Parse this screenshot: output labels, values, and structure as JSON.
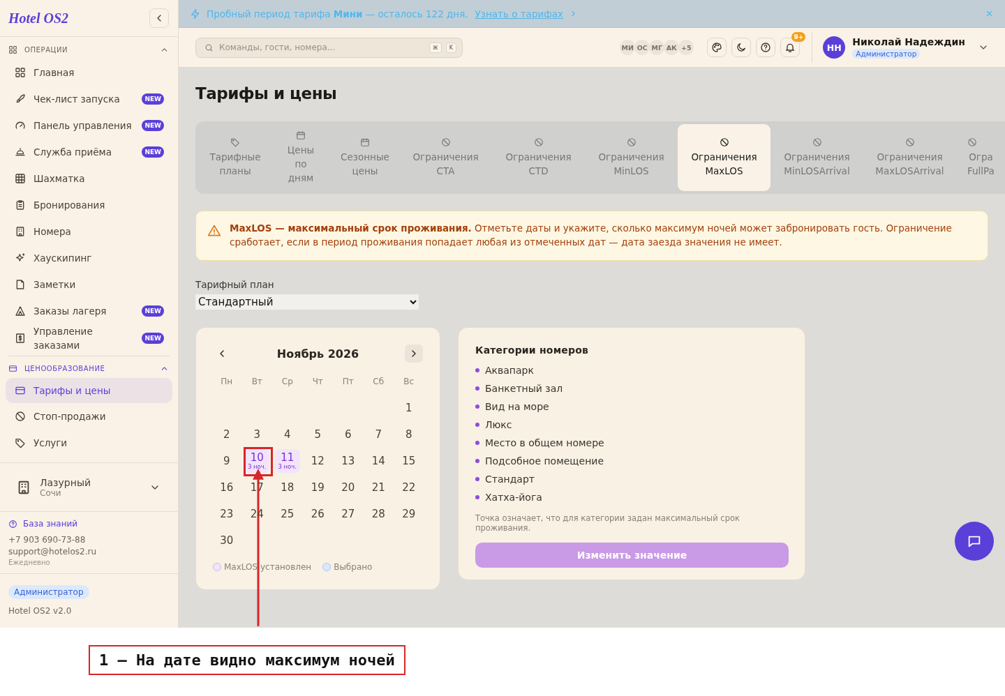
{
  "sidebar": {
    "logo": "Hotel OS2",
    "sections": [
      {
        "title": "ОПЕРАЦИИ",
        "active": false,
        "expanded": true,
        "items": [
          {
            "label": "Главная",
            "selected": false
          },
          {
            "label": "Чек-лист запуска",
            "badge": "NEW",
            "selected": false
          },
          {
            "label": "Панель управления",
            "badge": "NEW",
            "selected": false
          },
          {
            "label": "Служба приёма",
            "badge": "NEW",
            "selected": false
          },
          {
            "label": "Шахматка",
            "selected": false
          },
          {
            "label": "Бронирования",
            "selected": false
          },
          {
            "label": "Номера",
            "selected": false
          },
          {
            "label": "Хаускипинг",
            "selected": false
          },
          {
            "label": "Заметки",
            "selected": false
          },
          {
            "label": "Заказы лагеря",
            "badge": "NEW",
            "selected": false
          },
          {
            "label": "Управление заказами",
            "badge": "NEW",
            "selected": false
          }
        ]
      },
      {
        "title": "ЦЕНООБРАЗОВАНИЕ",
        "active": true,
        "expanded": true,
        "items": [
          {
            "label": "Тарифы и цены",
            "selected": true
          },
          {
            "label": "Стоп-продажи",
            "selected": false
          },
          {
            "label": "Услуги",
            "selected": false
          }
        ]
      }
    ],
    "hotel": {
      "name": "Лазурный",
      "city": "Сочи"
    },
    "support": {
      "link": "База знаний",
      "phone": "+7 903 690-73-88",
      "email": "support@hotelos2.ru",
      "hours": "Ежедневно"
    },
    "footer": {
      "role": "Администратор",
      "version": "Hotel OS2 v2.0"
    }
  },
  "banner": {
    "text": "Пробный период тарифа **Мини** — осталось 122 дня.",
    "link": "Узнать о тарифах"
  },
  "header": {
    "search": {
      "placeholder": "Команды, гости, номера...",
      "keys": [
        "⌘",
        "K"
      ]
    },
    "avatars": [
      "МИ",
      "ОС",
      "МГ",
      "АК",
      "+5"
    ],
    "notifications": "9+",
    "user": {
      "initials": "НН",
      "name": "Николай Надеждин",
      "role": "Администратор"
    }
  },
  "page": {
    "title": "Тарифы и цены",
    "tabs": [
      {
        "lines": [
          "Тарифные",
          "планы"
        ],
        "selected": false
      },
      {
        "lines": [
          "Цены",
          "по",
          "дням"
        ],
        "selected": false
      },
      {
        "lines": [
          "Сезонные",
          "цены"
        ],
        "selected": false
      },
      {
        "lines": [
          "Ограничения",
          "CTA"
        ],
        "selected": false
      },
      {
        "lines": [
          "Ограничения",
          "CTD"
        ],
        "selected": false
      },
      {
        "lines": [
          "Ограничения",
          "MinLOS"
        ],
        "selected": false
      },
      {
        "lines": [
          "Ограничения",
          "MaxLOS"
        ],
        "selected": true
      },
      {
        "lines": [
          "Ограничения",
          "MinLOSArrival"
        ],
        "selected": false
      },
      {
        "lines": [
          "Ограничения",
          "MaxLOSArrival"
        ],
        "selected": false
      },
      {
        "lines": [
          "Огра",
          "FullPa"
        ],
        "selected": false
      }
    ],
    "alert": "**MaxLOS — максимальный срок проживания.** Отметьте даты и укажите, сколько максимум ночей может забронировать гость. Ограничение сработает, если в период проживания попадает любая из отмеченных дат — дата заезда значения не имеет.",
    "rate_plan": {
      "label": "Тарифный план",
      "value": "Стандартный"
    },
    "calendar": {
      "month": "Ноябрь 2026",
      "weekdays": [
        "Пн",
        "Вт",
        "Ср",
        "Чт",
        "Пт",
        "Сб",
        "Вс"
      ],
      "weeks": [
        [
          {
            "day": "1",
            "maxlos": false,
            "selected": false,
            "marked": false
          }
        ],
        [
          {
            "day": "2",
            "maxlos": false,
            "selected": false,
            "marked": false
          },
          {
            "day": "3",
            "maxlos": false,
            "selected": false,
            "marked": false
          },
          {
            "day": "4",
            "maxlos": false,
            "selected": false,
            "marked": false
          },
          {
            "day": "5",
            "maxlos": false,
            "selected": false,
            "marked": false
          },
          {
            "day": "6",
            "maxlos": false,
            "selected": false,
            "marked": false
          },
          {
            "day": "7",
            "maxlos": false,
            "selected": false,
            "marked": false
          },
          {
            "day": "8",
            "maxlos": false,
            "selected": false,
            "marked": false
          }
        ],
        [
          {
            "day": "9",
            "maxlos": false,
            "selected": false,
            "marked": false
          },
          {
            "day": "10",
            "nights": "3 ноч.",
            "maxlos": true,
            "selected": false,
            "marked": true
          },
          {
            "day": "11",
            "nights": "3 ноч.",
            "maxlos": true,
            "selected": false,
            "marked": false
          },
          {
            "day": "12",
            "maxlos": false,
            "selected": false,
            "marked": false
          },
          {
            "day": "13",
            "maxlos": false,
            "selected": false,
            "marked": false
          },
          {
            "day": "14",
            "maxlos": false,
            "selected": false,
            "marked": false
          },
          {
            "day": "15",
            "maxlos": false,
            "selected": false,
            "marked": false
          }
        ],
        [
          {
            "day": "16",
            "maxlos": false,
            "selected": false,
            "marked": false
          },
          {
            "day": "17",
            "maxlos": false,
            "selected": false,
            "marked": false
          },
          {
            "day": "18",
            "maxlos": false,
            "selected": false,
            "marked": false
          },
          {
            "day": "19",
            "maxlos": false,
            "selected": false,
            "marked": false
          },
          {
            "day": "20",
            "maxlos": false,
            "selected": false,
            "marked": false
          },
          {
            "day": "21",
            "maxlos": false,
            "selected": false,
            "marked": false
          },
          {
            "day": "22",
            "maxlos": false,
            "selected": false,
            "marked": false
          }
        ],
        [
          {
            "day": "23",
            "maxlos": false,
            "selected": false,
            "marked": false
          },
          {
            "day": "24",
            "maxlos": false,
            "selected": false,
            "marked": false
          },
          {
            "day": "25",
            "maxlos": false,
            "selected": false,
            "marked": false
          },
          {
            "day": "26",
            "maxlos": false,
            "selected": false,
            "marked": false
          },
          {
            "day": "27",
            "maxlos": false,
            "selected": false,
            "marked": false
          },
          {
            "day": "28",
            "maxlos": false,
            "selected": false,
            "marked": false
          },
          {
            "day": "29",
            "maxlos": false,
            "selected": false,
            "marked": false
          }
        ],
        [
          {
            "day": "30",
            "maxlos": false,
            "selected": false,
            "marked": false
          }
        ]
      ],
      "legend": [
        "MaxLOS установлен",
        "Выбрано"
      ]
    },
    "categories": {
      "title": "Категории номеров",
      "items": [
        "Аквапарк",
        "Банкетный зал",
        "Вид на море",
        "Люкс",
        "Место в общем номере",
        "Подсобное помещение",
        "Стандарт",
        "Хатха-йога"
      ],
      "note": "Точка означает, что для категории задан максимальный срок проживания.",
      "button": "Изменить значение"
    }
  },
  "annotation": {
    "caption": "1 — На дате видно максимум ночей"
  }
}
